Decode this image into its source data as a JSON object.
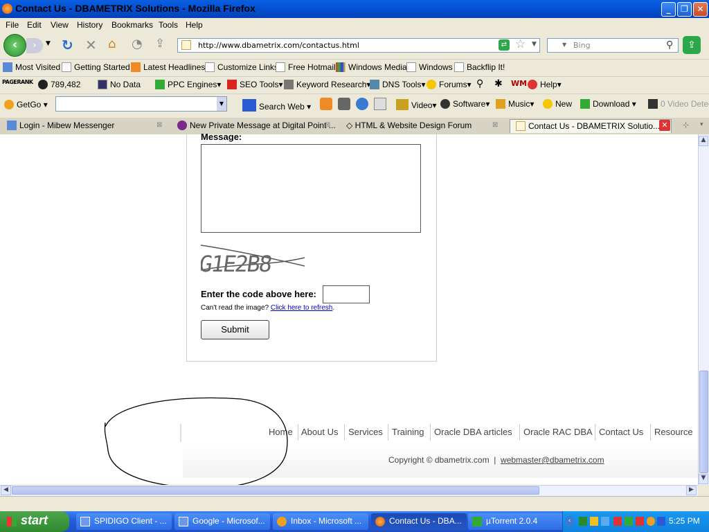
{
  "window": {
    "title": "Contact Us - DBAMETRIX Solutions - Mozilla Firefox"
  },
  "menu": [
    "File",
    "Edit",
    "View",
    "History",
    "Bookmarks",
    "Tools",
    "Help"
  ],
  "nav": {
    "url": "http://www.dbametrix.com/contactus.html",
    "search_placeholder": "Bing"
  },
  "bookmarks": [
    "Most Visited",
    "Getting Started",
    "Latest Headlines",
    "Customize Links",
    "Free Hotmail",
    "Windows Media",
    "Windows",
    "Backflip It!"
  ],
  "toolbar1": {
    "pagerank": "PAGERANK",
    "alexa": "789,482",
    "nodata": "No Data",
    "items": [
      "PPC Engines",
      "SEO Tools",
      "Keyword Research",
      "DNS Tools",
      "Forums",
      "Help"
    ]
  },
  "toolbar2": {
    "getgo": "GetGo",
    "search_web": "Search Web",
    "items": [
      "Video",
      "Software",
      "Music",
      "New",
      "Download",
      "0 Video Detec"
    ]
  },
  "tabs": [
    "Login - Mibew Messenger",
    "New Private Message at Digital Point ...",
    "HTML & Website Design Forum",
    "Contact Us - DBAMETRIX Solutio..."
  ],
  "form": {
    "message_label": "Message:",
    "captcha_text": "G1E2B8",
    "code_label": "Enter the code above here:",
    "refresh_prefix": "Can't read the image?",
    "refresh_link": "Click here to refresh",
    "refresh_suffix": ".",
    "submit": "Submit"
  },
  "footer": {
    "nav": [
      "Home",
      "About Us",
      "Services",
      "Training",
      "Oracle DBA articles",
      "Oracle RAC DBA",
      "Contact Us",
      "Resource"
    ],
    "copyright": "Copyright © dbametrix.com",
    "separator": "|",
    "email": "webmaster@dbametrix.com"
  },
  "taskbar": {
    "start": "start",
    "items": [
      "SPIDIGO Client - ...",
      "Google - Microsof...",
      "Inbox - Microsoft ...",
      "Contact Us - DBA...",
      "µTorrent 2.0.4"
    ],
    "clock": "5:25 PM"
  },
  "colors": {
    "titlebar": "#0454d6",
    "link": "#0000cc",
    "taskbar": "#245edb",
    "start": "#2f8a2f"
  }
}
